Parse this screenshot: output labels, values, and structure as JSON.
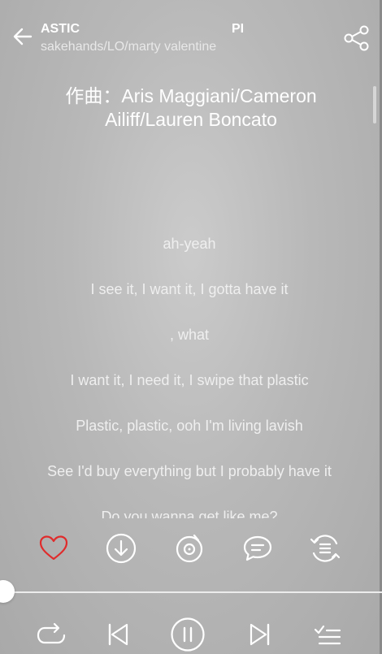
{
  "header": {
    "title_left": "ASTIC",
    "title_right": "PI",
    "subtitle": "sakehands/LO/marty valentine"
  },
  "lyrics": {
    "composer_line1": "作曲：Aris Maggiani/Cameron",
    "composer_line2": "Ailiff/Lauren Boncato",
    "lines": [
      "ah-yeah",
      "I see it, I want it, I gotta have it",
      ", what",
      "I want it, I need it, I swipe that plastic",
      "Plastic, plastic, ooh I'm living lavish",
      "See I'd buy everything but I probably have it",
      "Do you wanna get like me?"
    ]
  },
  "actions": [
    "heart-icon",
    "download-icon",
    "vinyl-icon",
    "comment-icon",
    "more-icon"
  ],
  "player": {
    "progress": 0.0
  },
  "colors": {
    "like": "#e02b2b",
    "icon": "#ffffff"
  }
}
